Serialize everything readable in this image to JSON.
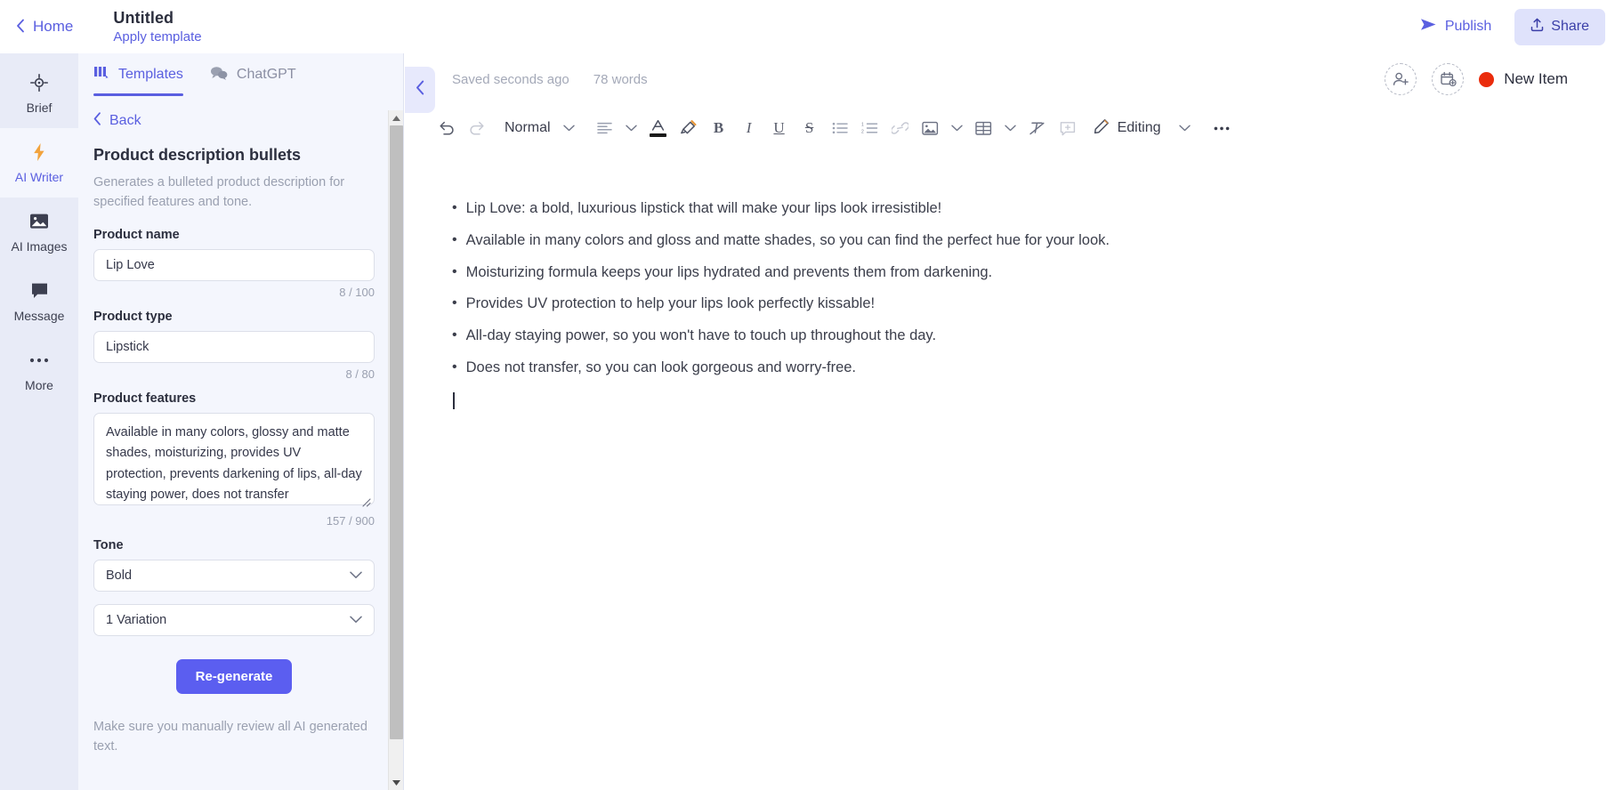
{
  "header": {
    "home_label": "Home",
    "doc_title": "Untitled",
    "apply_template": "Apply template",
    "publish_label": "Publish",
    "share_label": "Share"
  },
  "rail": {
    "items": [
      {
        "label": "Brief",
        "icon": "target-icon",
        "active": false
      },
      {
        "label": "AI Writer",
        "icon": "lightning-bolt-icon",
        "active": true
      },
      {
        "label": "AI Images",
        "icon": "image-icon",
        "active": false
      },
      {
        "label": "Message",
        "icon": "chat-bubble-icon",
        "active": false
      },
      {
        "label": "More",
        "icon": "ellipsis-icon",
        "active": false
      }
    ]
  },
  "panel": {
    "tabs": [
      {
        "label": "Templates",
        "icon": "templates-grid-icon",
        "active": true
      },
      {
        "label": "ChatGPT",
        "icon": "chat-bubbles-icon",
        "active": false
      }
    ],
    "back_label": "Back",
    "template_title": "Product description bullets",
    "template_desc": "Generates a bulleted product description for specified features and tone.",
    "fields": {
      "product_name": {
        "label": "Product name",
        "value": "Lip Love",
        "placeholder": "Product name",
        "counter": "8 / 100"
      },
      "product_type": {
        "label": "Product type",
        "value": "Lipstick",
        "placeholder": "Product type",
        "counter": "8 / 80"
      },
      "product_features": {
        "label": "Product features",
        "value": "Available in many colors, glossy and matte shades, moisturizing, provides UV protection, prevents darkening of lips, all-day staying power, does not transfer",
        "placeholder": "Product features",
        "counter": "157 / 900"
      },
      "tone": {
        "label": "Tone",
        "value": "Bold"
      },
      "variations": {
        "value": "1 Variation"
      }
    },
    "regenerate_label": "Re-generate",
    "disclaimer": "Make sure you manually review all AI generated text."
  },
  "editor": {
    "status_text": "Saved seconds ago",
    "word_count": "78 words",
    "new_item_label": "New Item",
    "new_item_color": "#ea2c0c",
    "toolbar": {
      "undo": "undo-icon",
      "redo": "redo-icon",
      "style_label": "Normal",
      "editing_label": "Editing"
    },
    "document": {
      "bullets": [
        "Lip Love: a bold, luxurious lipstick that will make your lips look irresistible!",
        "Available in many colors and gloss and matte shades, so you can find the perfect hue for your look.",
        "Moisturizing formula keeps your lips hydrated and prevents them from darkening.",
        "Provides UV protection to help your lips look perfectly kissable!",
        "All-day staying power, so you won't have to touch up throughout the day.",
        "Does not transfer, so you can look gorgeous and worry-free."
      ]
    }
  },
  "theme": {
    "accent": "#5a5fe0",
    "button": "#5b5ef0",
    "panel_bg": "#f4f6fd",
    "rail_bg": "#e8ebf7"
  }
}
